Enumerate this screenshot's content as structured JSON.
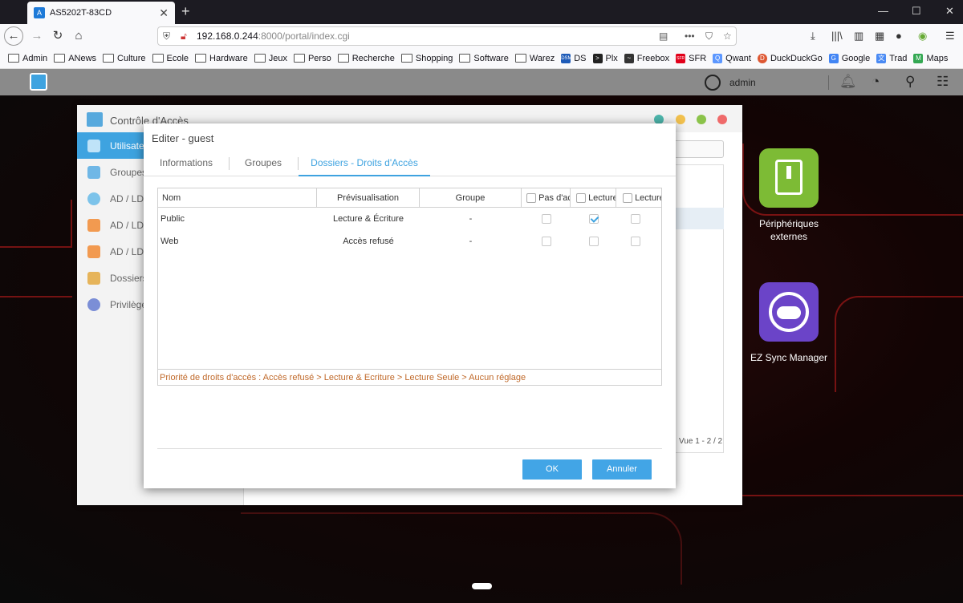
{
  "browser": {
    "tab_title": "AS5202T-83CD",
    "url_host": "192.168.0.244",
    "url_path": ":8000/portal/index.cgi",
    "bookmarks": [
      "Admin",
      "ANews",
      "Culture",
      "Ecole",
      "Hardware",
      "Jeux",
      "Perso",
      "Recherche",
      "Shopping",
      "Software",
      "Warez"
    ],
    "bookmarks_icons": [
      {
        "label": "DS",
        "icon": "dsm-icon",
        "color": "#1e5bb8",
        "text": "DSM"
      },
      {
        "label": "Plx",
        "icon": "plex-icon",
        "color": "#222222",
        "text": ">"
      },
      {
        "label": "Freebox",
        "icon": "freebox-icon",
        "color": "#333333",
        "text": "~"
      },
      {
        "label": "SFR",
        "icon": "sfr-icon",
        "color": "#e2001a",
        "text": "SFR"
      },
      {
        "label": "Qwant",
        "icon": "qwant-icon",
        "color": "#5c97ff",
        "text": "Q"
      },
      {
        "label": "DuckDuckGo",
        "icon": "duckduckgo-icon",
        "color": "#de5833",
        "text": "D"
      },
      {
        "label": "Google",
        "icon": "google-icon",
        "color": "#4285f4",
        "text": "G"
      },
      {
        "label": "Trad",
        "icon": "translate-icon",
        "color": "#4a8af4",
        "text": "文"
      },
      {
        "label": "Maps",
        "icon": "maps-icon",
        "color": "#34a853",
        "text": "M"
      }
    ]
  },
  "adm": {
    "user": "admin"
  },
  "desktop": {
    "apps": [
      {
        "label": "Périphériques externes",
        "icon": "usb-drive-icon",
        "color": "#7dbb35"
      },
      {
        "label": "EZ Sync Manager",
        "icon": "ez-sync-icon",
        "color": "#6b44c8"
      }
    ]
  },
  "main_window": {
    "title": "Contrôle d'Accès",
    "sidebar": [
      {
        "label": "Utilisateurs",
        "icon": "user-icon",
        "active": true
      },
      {
        "label": "Groupes",
        "icon": "group-icon",
        "active": false
      },
      {
        "label": "AD / LDAP",
        "icon": "key-icon",
        "active": false
      },
      {
        "label": "AD / LDAP",
        "icon": "ad-user-icon",
        "active": false
      },
      {
        "label": "AD / LDAP",
        "icon": "ad-group-icon",
        "active": false
      },
      {
        "label": "Dossiers",
        "icon": "folder-icon",
        "active": false
      },
      {
        "label": "Privilèges",
        "icon": "privilege-icon",
        "active": false
      }
    ],
    "view_count": "Vue 1 - 2 / 2"
  },
  "dialog": {
    "title": "Editer - guest",
    "tabs": [
      {
        "label": "Informations",
        "active": false
      },
      {
        "label": "Groupes",
        "active": false
      },
      {
        "label": "Dossiers - Droits d'Accès",
        "active": true
      }
    ],
    "columns": [
      "Nom",
      "Prévisualisation",
      "Groupe",
      "Pas d'accès",
      "Lecture & Écriture",
      "Lecture Seule"
    ],
    "rows": [
      {
        "nom": "Public",
        "preview": "Lecture & Écriture",
        "groupe": "-",
        "no_access": false,
        "read_write": true,
        "read_only": false
      },
      {
        "nom": "Web",
        "preview": "Accès refusé",
        "groupe": "-",
        "no_access": false,
        "read_write": false,
        "read_only": false
      }
    ],
    "priority_note": "Priorité de droits d'accès : Accès refusé > Lecture & Ecriture > Lecture Seule > Aucun réglage",
    "ok_label": "OK",
    "cancel_label": "Annuler"
  }
}
